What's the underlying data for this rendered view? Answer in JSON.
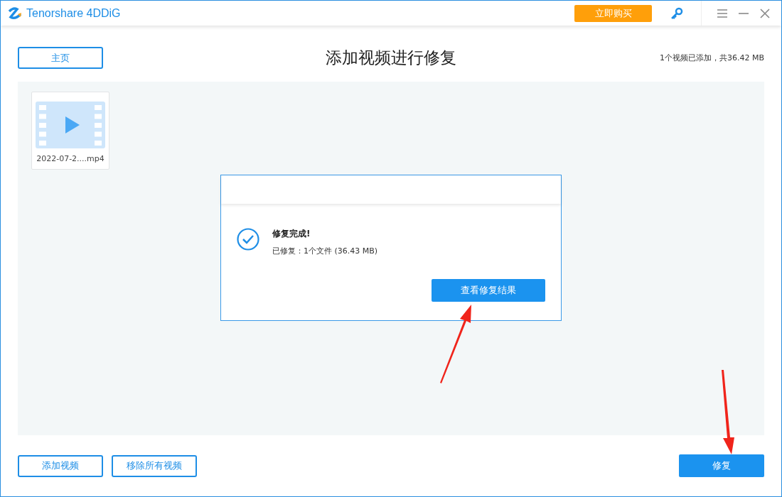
{
  "window": {
    "title": "Tenorshare 4DDiG",
    "buy_button": "立即购买"
  },
  "header": {
    "home_button": "主页",
    "heading": "添加视频进行修复",
    "summary": "1个视频已添加，共36.42 MB"
  },
  "videos": [
    {
      "name": "2022-07-2....mp4"
    }
  ],
  "dialog": {
    "title": "修复完成!",
    "detail": "已修复：1个文件 (36.43 MB)",
    "button": "查看修复结果"
  },
  "footer": {
    "buttons": [
      "添加视频",
      "移除所有视频"
    ],
    "repair_button": "修复"
  }
}
